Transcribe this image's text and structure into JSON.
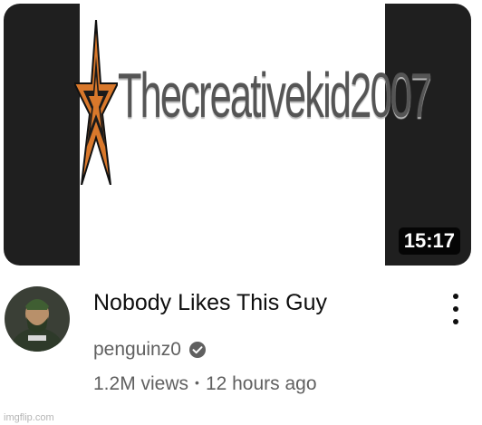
{
  "video": {
    "thumbnail_text": "Thecreativekid2007",
    "duration": "15:17",
    "title": "Nobody Likes This Guy",
    "channel_name": "penguinz0",
    "verified_icon": "check-circle-icon",
    "views": "1.2M views",
    "separator": "•",
    "uploaded": "12 hours ago",
    "more_icon": "vertical-ellipsis-icon"
  },
  "watermark": "imgflip.com",
  "colors": {
    "thumbnail_bars": "#1f1f1f",
    "star_orange": "#d9782b",
    "text_primary": "#0f0f0f",
    "text_secondary": "#606060",
    "duration_badge": "#000000"
  }
}
